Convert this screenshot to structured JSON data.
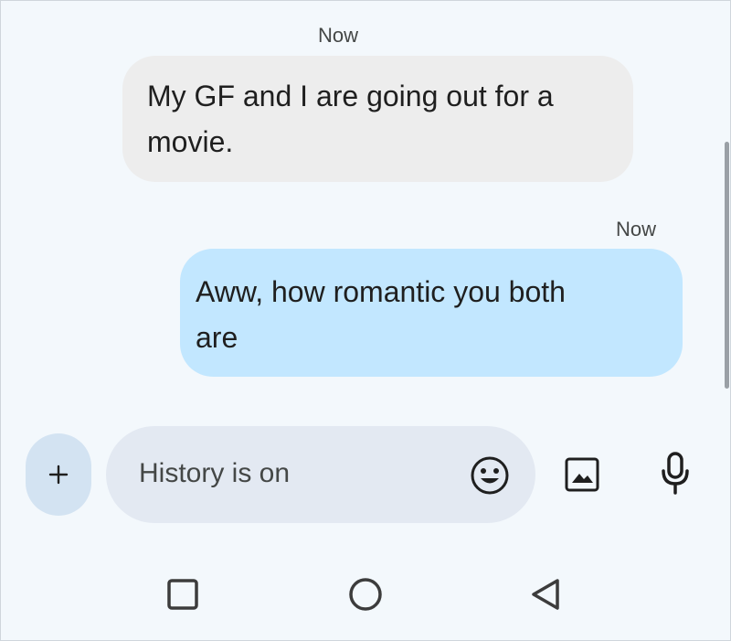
{
  "messages": [
    {
      "direction": "incoming",
      "timestamp": "Now",
      "line1": "My GF and I are going out for a",
      "line2": "movie."
    },
    {
      "direction": "outgoing",
      "timestamp": "Now",
      "line1": "Aww, how romantic you both",
      "line2": "are"
    }
  ],
  "compose": {
    "placeholder": "History is on",
    "plus_icon": "plus-icon",
    "emoji_icon": "emoji-icon",
    "gallery_icon": "image-icon",
    "mic_icon": "microphone-icon"
  },
  "nav": {
    "recents_icon": "square-icon",
    "home_icon": "circle-icon",
    "back_icon": "triangle-back-icon"
  },
  "colors": {
    "background": "#f3f8fc",
    "incoming_bubble": "#ededed",
    "outgoing_bubble": "#c2e7ff",
    "compose_field": "#e3e9f2",
    "plus_button": "#d3e3f2"
  }
}
